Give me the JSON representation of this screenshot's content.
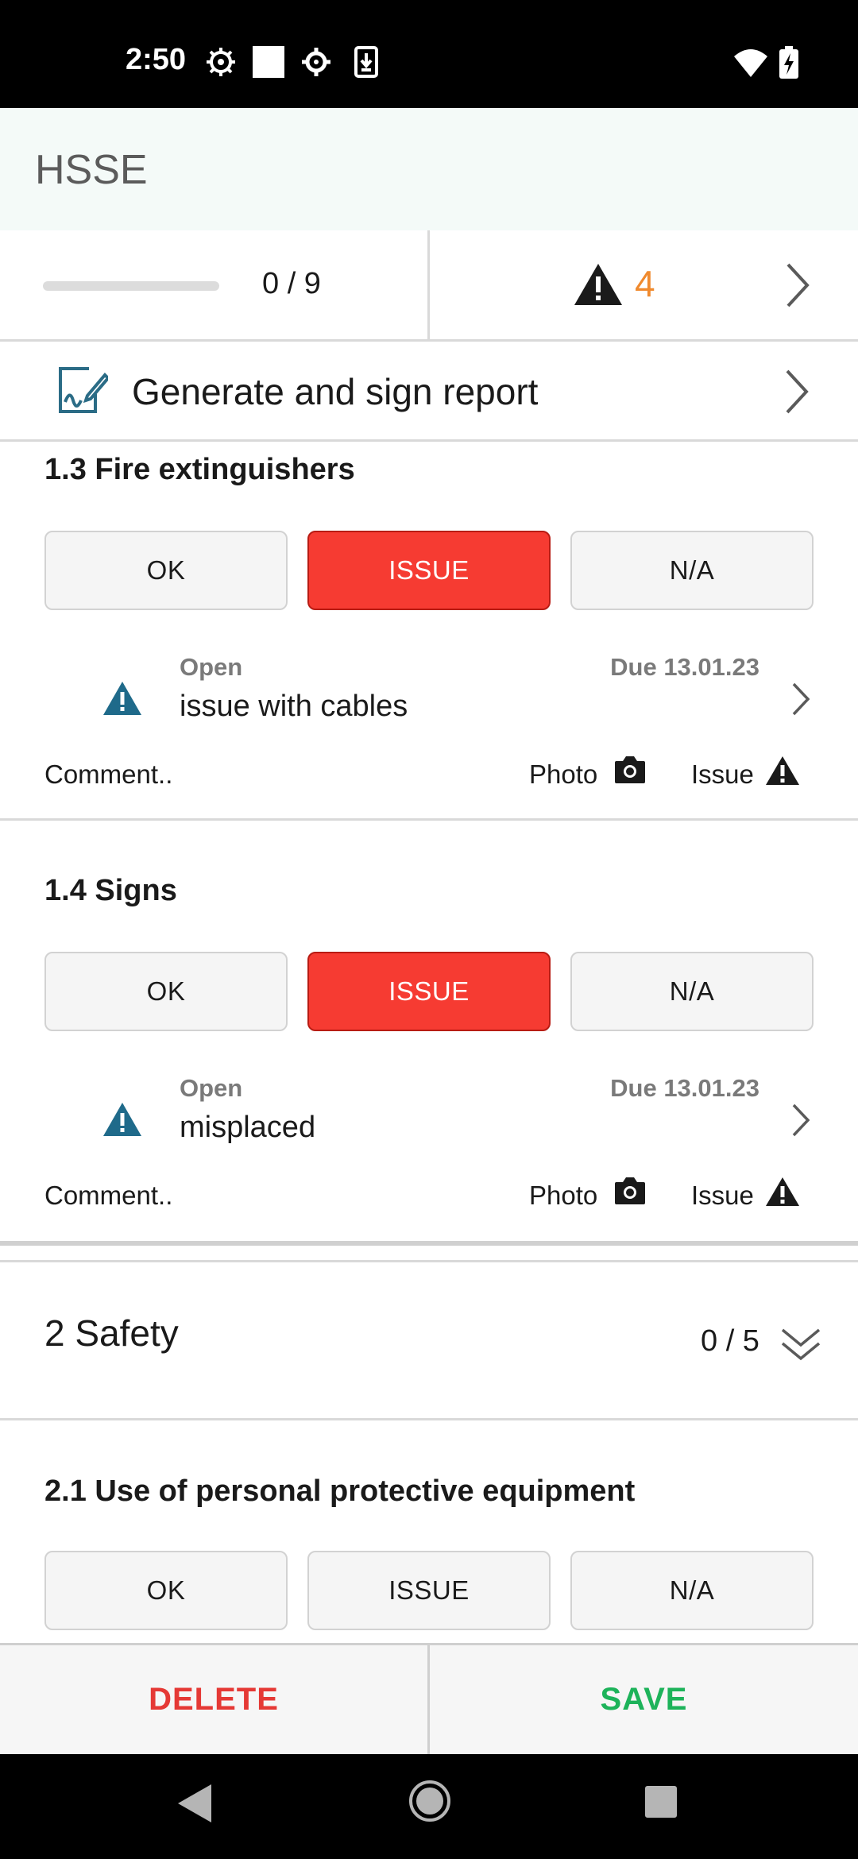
{
  "status_bar": {
    "time": "2:50",
    "left_icons": [
      "gear-chip-icon",
      "white-square-icon",
      "settings-icon",
      "download-icon"
    ],
    "right_icons": [
      "wifi-icon",
      "battery-charging-icon"
    ]
  },
  "app_header": {
    "title": "HSSE"
  },
  "progress": {
    "count_text": "0 / 9",
    "fraction": 0
  },
  "issues_summary": {
    "count": "4",
    "accent": "#f08a2e"
  },
  "report": {
    "label": "Generate and sign report"
  },
  "items": [
    {
      "title": "1.3 Fire extinguishers",
      "buttons": {
        "ok": "OK",
        "issue": "ISSUE",
        "na": "N/A"
      },
      "selected": "issue",
      "issue": {
        "status": "Open",
        "description": "issue with cables",
        "due": "Due 13.01.23"
      },
      "actions": {
        "comment": "Comment..",
        "photo": "Photo",
        "issue": "Issue"
      }
    },
    {
      "title": "1.4 Signs",
      "buttons": {
        "ok": "OK",
        "issue": "ISSUE",
        "na": "N/A"
      },
      "selected": "issue",
      "issue": {
        "status": "Open",
        "description": "misplaced",
        "due": "Due 13.01.23"
      },
      "actions": {
        "comment": "Comment..",
        "photo": "Photo",
        "issue": "Issue"
      }
    },
    {
      "title": "2.1 Use of personal protective equipment",
      "buttons": {
        "ok": "OK",
        "issue": "ISSUE",
        "na": "N/A"
      },
      "selected": ""
    }
  ],
  "section": {
    "title": "2 Safety",
    "count_text": "0 / 5"
  },
  "bottom_bar": {
    "delete_label": "DELETE",
    "save_label": "SAVE",
    "delete_color": "#e53935",
    "save_color": "#1db35a"
  },
  "colors": {
    "issue_active": "#f63b32",
    "warning_blue": "#1f6a8a"
  }
}
